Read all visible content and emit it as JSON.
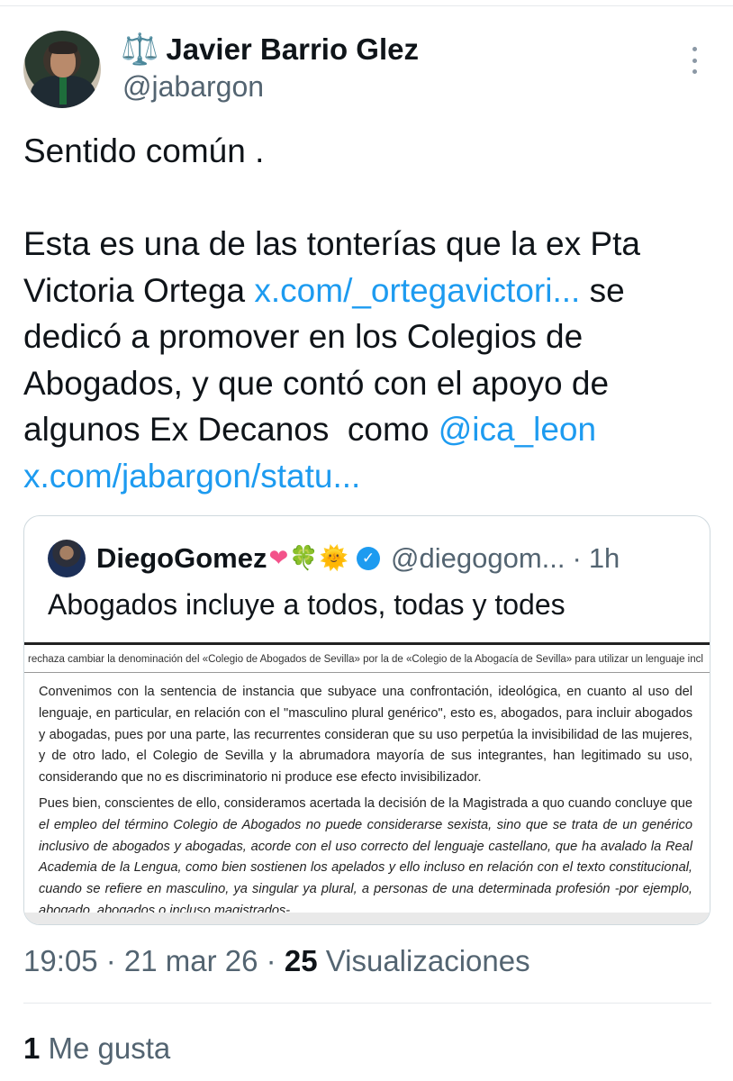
{
  "author": {
    "emoji": "⚖️",
    "display_name": "Javier Barrio Glez",
    "handle": "@jabargon"
  },
  "tweet": {
    "line1": "Sentido común .",
    "seg1": "Esta es una de las tonterías que la ex Pta Victoria Ortega ",
    "link1": "x.com/_ortegavictori...",
    "seg2": " se dedicó a promover en los Colegios de Abogados, y que contó con el apoyo de algunos Ex Decanos  como ",
    "mention": "@ica_leon",
    "link2": "x.com/jabargon/statu..."
  },
  "quote": {
    "name": "DiegoGomez",
    "emojis": {
      "heart": "❤",
      "clover": "🍀",
      "sun": "🌞"
    },
    "verified": "✓",
    "handle": "@diegogom...",
    "separator": "·",
    "time": "1h",
    "text": "Abogados incluye a todos, todas y todes",
    "image": {
      "header": "rechaza cambiar la denominación del «Colegio de Abogados de Sevilla» por la de «Colegio de la Abogacía de Sevilla» para utilizar un lenguaje incl",
      "para1": "Convenimos con la sentencia de instancia que subyace una confrontación, ideológica, en cuanto al uso del lenguaje, en particular, en relación con el \"masculino plural genérico\", esto es, abogados, para incluir abogados y abogadas, pues por una parte, las recurrentes consideran que su uso perpetúa la invisibilidad de las mujeres, y de otro lado, el Colegio de Sevilla y la abrumadora mayoría de sus integrantes, han legitimado su uso, considerando que no es discriminatorio ni produce ese efecto invisibilizador.",
      "para2_a": "Pues bien, conscientes de ello, consideramos acertada la decisión de la Magistrada a quo cuando concluye que ",
      "para2_b": "el empleo del término Colegio de Abogados no puede considerarse sexista, sino que se trata de un genérico inclusivo de abogados y abogadas, acorde con el uso correcto del lenguaje castellano, que ha avalado la Real Academia de la Lengua, como bien sostienen los apelados y ello incluso en relación con el texto constitucional, cuando se refiere en masculino, ya singular ya plural, a personas de una determinada profesión -por ejemplo, abogado, abogados o incluso magistrados-."
    }
  },
  "meta": {
    "time": "19:05",
    "sep1": " · ",
    "date": "21 mar 26",
    "sep2": " · ",
    "views_count": "25",
    "views_label": " Visualizaciones"
  },
  "likes": {
    "count": "1",
    "label": " Me gusta"
  }
}
